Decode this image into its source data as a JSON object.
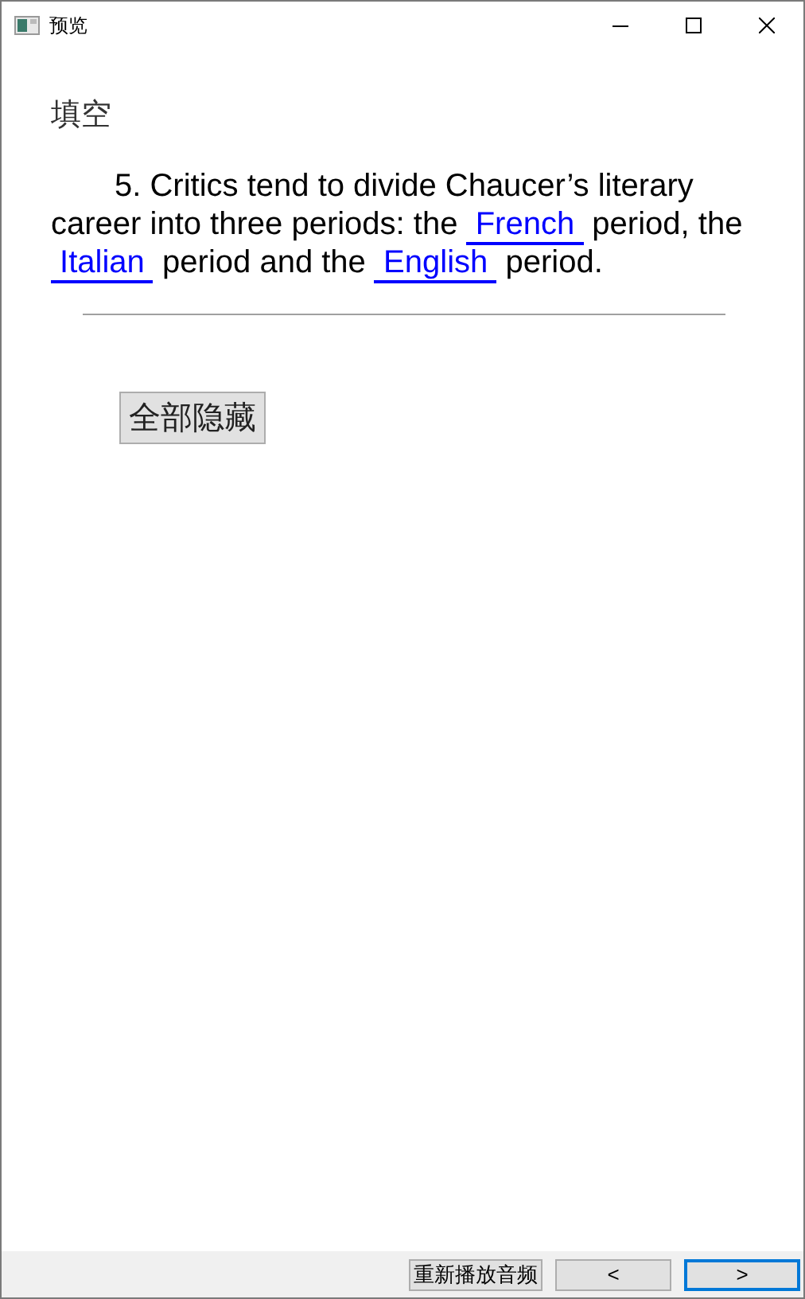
{
  "window": {
    "title": "预览"
  },
  "heading": "填空",
  "question": [
    {
      "kind": "text",
      "text": "5. Critics tend to divide Chaucer’s literary career into three periods: the "
    },
    {
      "kind": "blank",
      "text": " French "
    },
    {
      "kind": "text",
      "text": " period, the "
    },
    {
      "kind": "blank",
      "text": " Italian "
    },
    {
      "kind": "text",
      "text": " period and the "
    },
    {
      "kind": "blank",
      "text": " English "
    },
    {
      "kind": "text",
      "text": " period."
    }
  ],
  "hide_button": "全部隐藏",
  "footer_buttons": [
    {
      "label": "重新播放音频",
      "focused": false
    },
    {
      "label": "<",
      "focused": false
    },
    {
      "label": ">",
      "focused": true
    }
  ]
}
